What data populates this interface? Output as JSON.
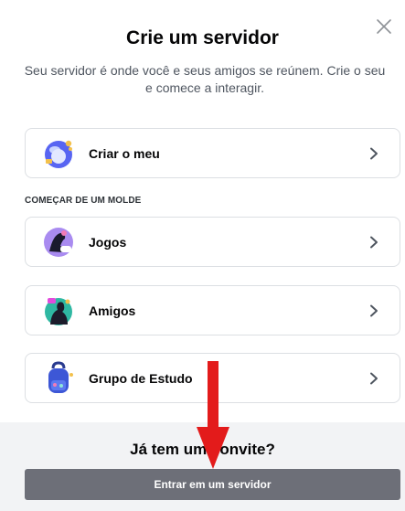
{
  "modal": {
    "title": "Crie um servidor",
    "subtitle": "Seu servidor é onde você e seus amigos se reúnem. Crie o seu e comece a interagir.",
    "close_icon": "close-icon"
  },
  "create_own": {
    "label": "Criar o meu",
    "icon": "globe-illustration-icon"
  },
  "templates": {
    "section_label": "COMEÇAR DE UM MOLDE",
    "items": [
      {
        "label": "Jogos",
        "icon": "gaming-illustration-icon"
      },
      {
        "label": "Amigos",
        "icon": "friends-illustration-icon"
      },
      {
        "label": "Grupo de Estudo",
        "icon": "backpack-illustration-icon"
      }
    ]
  },
  "footer": {
    "question": "Já tem um convite?",
    "join_button": "Entrar em um servidor"
  },
  "annotation": {
    "arrow_color": "#e31b1b"
  },
  "colors": {
    "title": "#060607",
    "subtitle": "#4f5660",
    "card_border": "#dcdfe3",
    "footer_bg": "#f2f3f5",
    "join_button_bg": "#6d6f78"
  }
}
